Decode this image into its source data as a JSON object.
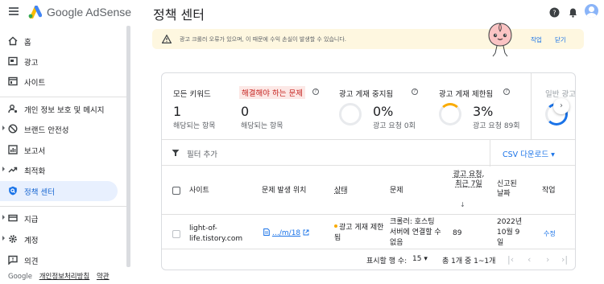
{
  "header": {
    "logo_text": "Google AdSense",
    "page_title": "정책 센터"
  },
  "sidebar": {
    "items": [
      {
        "label": "홈",
        "icon": "home-icon"
      },
      {
        "label": "광고",
        "icon": "ads-icon"
      },
      {
        "label": "사이트",
        "icon": "sites-icon"
      },
      {
        "label": "개인 정보 보호 및 메시지",
        "icon": "privacy-icon"
      },
      {
        "label": "브랜드 안전성",
        "icon": "block-icon"
      },
      {
        "label": "보고서",
        "icon": "reports-icon"
      },
      {
        "label": "최적화",
        "icon": "trending-icon"
      },
      {
        "label": "정책 센터",
        "icon": "policy-icon"
      },
      {
        "label": "지급",
        "icon": "payments-icon"
      },
      {
        "label": "계정",
        "icon": "settings-icon"
      },
      {
        "label": "의견",
        "icon": "feedback-icon"
      }
    ],
    "footer": {
      "brand": "Google",
      "privacy": "개인정보처리방침",
      "terms": "약관"
    }
  },
  "banner": {
    "message": "광고 크롤러 오류가 있으며, 이 때문에 수익 손실이 발생할 수 있습니다.",
    "action_label": "작업",
    "dismiss_label": "닫기"
  },
  "summary": {
    "all_keywords": {
      "title": "모든 키워드",
      "value": "1",
      "sub": "해당되는 항목"
    },
    "must_fix": {
      "title": "해결해야 하는 문제",
      "value": "0",
      "sub": "해당되는 항목"
    },
    "ad_serving_disabled": {
      "title": "광고 게재 중지됨",
      "value": "0%",
      "sub": "광고 요청 0회"
    },
    "ad_serving_limited": {
      "title": "광고 게재 제한됨",
      "value": "3%",
      "sub": "광고 요청 89회"
    },
    "partial_title": "일반 광고"
  },
  "filter": {
    "label": "필터 추가",
    "csv_label": "CSV 다운로드 ▾"
  },
  "table": {
    "headers": {
      "site": "사이트",
      "location": "문제 발생 위치",
      "status": "상태",
      "issue": "문제",
      "requests": "광고 요청, 최근 7일",
      "reported": "신고된 날짜",
      "action": "작업"
    },
    "rows": [
      {
        "site": "light-of-life.tistory.com",
        "location": "…/m/18",
        "status": "광고 게재 제한됨",
        "issue": "크롤러: 호스팅 서버에 연결할 수 없음",
        "requests": "89",
        "reported": "2022년 10월 9일",
        "action": "수정"
      }
    ]
  },
  "pagination": {
    "rows_label": "표시할 행 수:",
    "rows_value": "15 ▾",
    "range": "총 1개 중 1~1개"
  },
  "colors": {
    "accent": "#1a73e8",
    "active_bg": "#e8f0fe",
    "banner_bg": "#fef7e0",
    "warning": "#f9ab00",
    "error_bg": "#fce8e6"
  }
}
